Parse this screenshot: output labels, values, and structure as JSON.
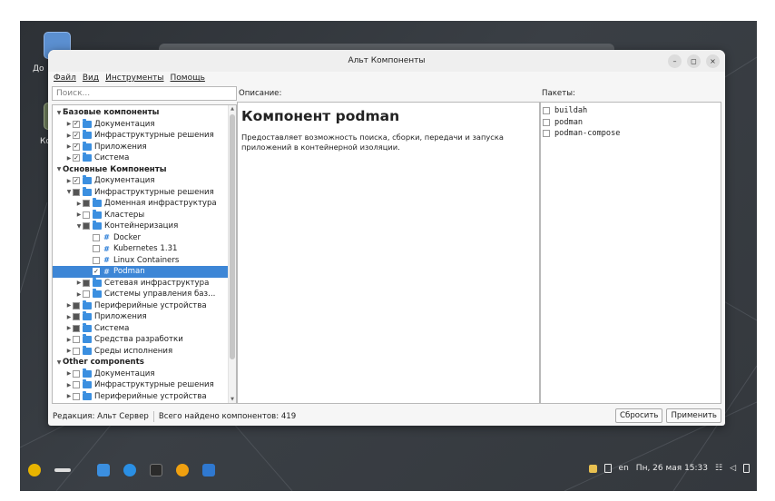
{
  "window": {
    "title": "Альт Компоненты",
    "controls": {
      "minimize": "–",
      "maximize": "◻",
      "close": "×"
    }
  },
  "menu": [
    "Файл",
    "Вид",
    "Инструменты",
    "Помощь"
  ],
  "search": {
    "placeholder": "Поиск..."
  },
  "tree": [
    {
      "label": "Базовые компоненты",
      "level": 0,
      "arrow": "down",
      "check": "none",
      "icon": "none",
      "bold": true
    },
    {
      "label": "Документация",
      "level": 1,
      "arrow": "right",
      "check": "checked",
      "icon": "folder"
    },
    {
      "label": "Инфраструктурные решения",
      "level": 1,
      "arrow": "right",
      "check": "checked",
      "icon": "folder"
    },
    {
      "label": "Приложения",
      "level": 1,
      "arrow": "right",
      "check": "checked",
      "icon": "folder"
    },
    {
      "label": "Система",
      "level": 1,
      "arrow": "right",
      "check": "checked",
      "icon": "folder"
    },
    {
      "label": "Основные Компоненты",
      "level": 0,
      "arrow": "down",
      "check": "none",
      "icon": "none",
      "bold": true
    },
    {
      "label": "Документация",
      "level": 1,
      "arrow": "right",
      "check": "checked",
      "icon": "folder"
    },
    {
      "label": "Инфраструктурные решения",
      "level": 1,
      "arrow": "down",
      "check": "partial",
      "icon": "folder"
    },
    {
      "label": "Доменная инфраструктура",
      "level": 2,
      "arrow": "right",
      "check": "partial",
      "icon": "folder"
    },
    {
      "label": "Кластеры",
      "level": 2,
      "arrow": "right",
      "check": "unchecked",
      "icon": "folder"
    },
    {
      "label": "Контейнеризация",
      "level": 2,
      "arrow": "down",
      "check": "partial",
      "icon": "folder"
    },
    {
      "label": "Docker",
      "level": 3,
      "arrow": "none",
      "check": "unchecked",
      "icon": "package"
    },
    {
      "label": "Kubernetes 1.31",
      "level": 3,
      "arrow": "none",
      "check": "unchecked",
      "icon": "package"
    },
    {
      "label": "Linux Containers",
      "level": 3,
      "arrow": "none",
      "check": "unchecked",
      "icon": "package"
    },
    {
      "label": "Podman",
      "level": 3,
      "arrow": "none",
      "check": "checked",
      "icon": "package",
      "selected": true
    },
    {
      "label": "Сетевая инфраструктура",
      "level": 2,
      "arrow": "right",
      "check": "partial",
      "icon": "folder"
    },
    {
      "label": "Системы управления баз...",
      "level": 2,
      "arrow": "right",
      "check": "unchecked",
      "icon": "folder"
    },
    {
      "label": "Периферийные устройства",
      "level": 1,
      "arrow": "right",
      "check": "partial",
      "icon": "folder"
    },
    {
      "label": "Приложения",
      "level": 1,
      "arrow": "right",
      "check": "partial",
      "icon": "folder"
    },
    {
      "label": "Система",
      "level": 1,
      "arrow": "right",
      "check": "partial",
      "icon": "folder"
    },
    {
      "label": "Средства разработки",
      "level": 1,
      "arrow": "right",
      "check": "unchecked",
      "icon": "folder"
    },
    {
      "label": "Среды исполнения",
      "level": 1,
      "arrow": "right",
      "check": "unchecked",
      "icon": "folder"
    },
    {
      "label": "Other components",
      "level": 0,
      "arrow": "down",
      "check": "none",
      "icon": "none",
      "bold": true
    },
    {
      "label": "Документация",
      "level": 1,
      "arrow": "right",
      "check": "unchecked",
      "icon": "folder"
    },
    {
      "label": "Инфраструктурные решения",
      "level": 1,
      "arrow": "right",
      "check": "unchecked",
      "icon": "folder"
    },
    {
      "label": "Периферийные устройства",
      "level": 1,
      "arrow": "right",
      "check": "unchecked",
      "icon": "folder"
    }
  ],
  "description": {
    "header": "Описание:",
    "title": "Компонент podman",
    "text": "Предоставляет возможность поиска, сборки, передачи и запуска приложений в контейнерной изоляции."
  },
  "packages": {
    "header": "Пакеты:",
    "items": [
      "buildah",
      "podman",
      "podman-compose"
    ]
  },
  "status": {
    "edition": "Редакция: Альт Сервер",
    "found": "Всего найдено компонентов: 419",
    "reset_label": "Сбросить",
    "apply_label": "Применить"
  },
  "desktop": {
    "icon_labels": [
      "До",
      "Ко"
    ]
  },
  "taskbar": {
    "lang": "en",
    "clock": "Пн, 26 мая 15:33"
  },
  "colors": {
    "selection": "#3d86d6",
    "folder": "#3b8fe0",
    "desktop": "#34383d"
  }
}
